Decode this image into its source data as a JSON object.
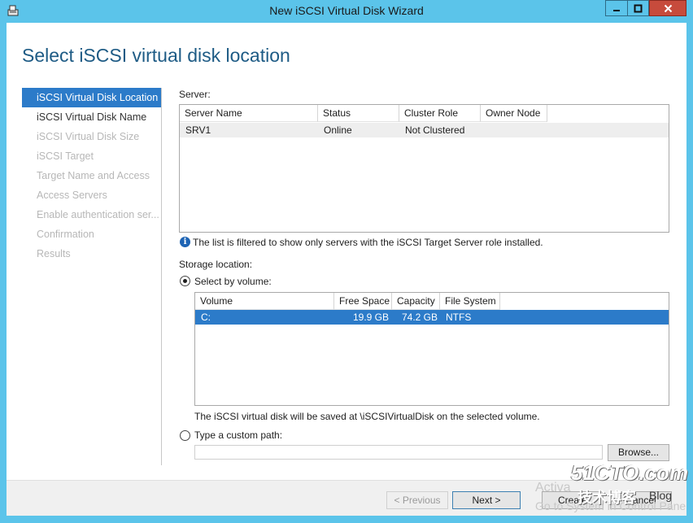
{
  "window": {
    "title": "New iSCSI Virtual Disk Wizard",
    "controls": {
      "minimize": "—",
      "maximize": "□",
      "close": "✕"
    }
  },
  "page": {
    "heading": "Select iSCSI virtual disk location"
  },
  "nav": {
    "items": [
      {
        "label": "iSCSI Virtual Disk Location",
        "state": "active"
      },
      {
        "label": "iSCSI Virtual Disk Name",
        "state": "enabled"
      },
      {
        "label": "iSCSI Virtual Disk Size",
        "state": "disabled"
      },
      {
        "label": "iSCSI Target",
        "state": "disabled"
      },
      {
        "label": "Target Name and Access",
        "state": "disabled"
      },
      {
        "label": "Access Servers",
        "state": "disabled"
      },
      {
        "label": "Enable authentication ser...",
        "state": "disabled"
      },
      {
        "label": "Confirmation",
        "state": "disabled"
      },
      {
        "label": "Results",
        "state": "disabled"
      }
    ]
  },
  "server": {
    "label": "Server:",
    "columns": [
      "Server Name",
      "Status",
      "Cluster Role",
      "Owner Node"
    ],
    "rows": [
      {
        "name": "SRV1",
        "status": "Online",
        "cluster_role": "Not Clustered",
        "owner_node": ""
      }
    ],
    "info": "The list is filtered to show only servers with the iSCSI Target Server role installed."
  },
  "storage": {
    "label": "Storage location:",
    "select_by_volume": "Select by volume:",
    "select_by_volume_checked": true,
    "columns": [
      "Volume",
      "Free Space",
      "Capacity",
      "File System"
    ],
    "rows": [
      {
        "volume": "C:",
        "free_space": "19.9 GB",
        "capacity": "74.2 GB",
        "file_system": "NTFS"
      }
    ],
    "note": "The iSCSI virtual disk will be saved at \\iSCSIVirtualDisk on the selected volume.",
    "custom_path_label": "Type a custom path:",
    "custom_path_checked": false,
    "custom_path_value": "",
    "browse_label": "Browse..."
  },
  "footer": {
    "previous": "< Previous",
    "next": "Next >",
    "create": "Create",
    "cancel": "Cancel"
  },
  "overlay": {
    "activate_line1": "Activa",
    "activate_line2": "Go to System in Control Pane",
    "brand": "51CTO.com",
    "brand_sub": "技术博客",
    "brand_blog": "Blog"
  },
  "colors": {
    "titlebar": "#5bc4ea",
    "selection": "#2c7bc9",
    "heading": "#1e5b85"
  }
}
